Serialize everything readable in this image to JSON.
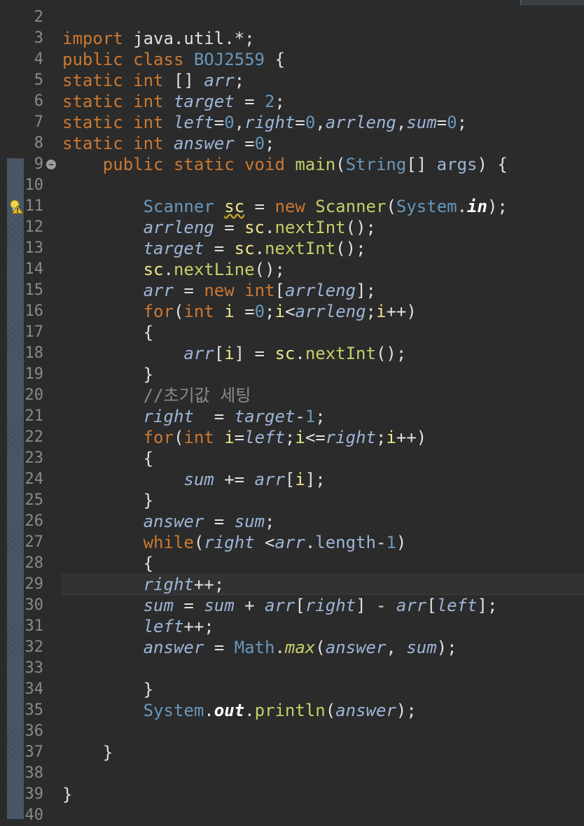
{
  "editor": {
    "lines": [
      {
        "n": "2"
      },
      {
        "n": "3"
      },
      {
        "n": "4"
      },
      {
        "n": "5"
      },
      {
        "n": "6"
      },
      {
        "n": "7"
      },
      {
        "n": "8"
      },
      {
        "n": "9"
      },
      {
        "n": "10"
      },
      {
        "n": "11"
      },
      {
        "n": "12"
      },
      {
        "n": "13"
      },
      {
        "n": "14"
      },
      {
        "n": "15"
      },
      {
        "n": "16"
      },
      {
        "n": "17"
      },
      {
        "n": "18"
      },
      {
        "n": "19"
      },
      {
        "n": "20"
      },
      {
        "n": "21"
      },
      {
        "n": "22"
      },
      {
        "n": "23"
      },
      {
        "n": "24"
      },
      {
        "n": "25"
      },
      {
        "n": "26"
      },
      {
        "n": "27"
      },
      {
        "n": "28"
      },
      {
        "n": "29"
      },
      {
        "n": "30"
      },
      {
        "n": "31"
      },
      {
        "n": "32"
      },
      {
        "n": "33"
      },
      {
        "n": "34"
      },
      {
        "n": "35"
      },
      {
        "n": "36"
      },
      {
        "n": "37"
      },
      {
        "n": "38"
      },
      {
        "n": "39"
      },
      {
        "n": "40"
      }
    ],
    "tokens": {
      "l3": [
        "import",
        " java.util.*;"
      ],
      "l4": [
        "public",
        " ",
        "class",
        " ",
        "BOJ2559",
        " {"
      ],
      "l5": [
        "static",
        " ",
        "int",
        " [] ",
        "arr",
        ";"
      ],
      "l6": [
        "static",
        " ",
        "int",
        " ",
        "target",
        " = ",
        "2",
        ";"
      ],
      "l7": [
        "static",
        " ",
        "int",
        " ",
        "left",
        "=",
        "0",
        ",",
        "right",
        "=",
        "0",
        ",",
        "arrleng",
        ",",
        "sum",
        "=",
        "0",
        ";"
      ],
      "l8": [
        "static",
        " ",
        "int",
        " ",
        "answer",
        " =",
        "0",
        ";"
      ],
      "l9": [
        "    ",
        "public",
        " ",
        "static",
        " ",
        "void",
        " ",
        "main",
        "(",
        "String",
        "[] ",
        "args",
        ") {"
      ],
      "l11": [
        "        ",
        "Scanner",
        " ",
        "sc",
        " = ",
        "new",
        " ",
        "Scanner",
        "(",
        "System",
        ".",
        "in",
        ");"
      ],
      "l12": [
        "        ",
        "arrleng",
        " = ",
        "sc",
        ".",
        "nextInt",
        "();"
      ],
      "l13": [
        "        ",
        "target",
        " = ",
        "sc",
        ".",
        "nextInt",
        "();"
      ],
      "l14": [
        "        ",
        "sc",
        ".",
        "nextLine",
        "();"
      ],
      "l15": [
        "        ",
        "arr",
        " = ",
        "new",
        " ",
        "int",
        "[",
        "arrleng",
        "];"
      ],
      "l16": [
        "        ",
        "for",
        "(",
        "int",
        " ",
        "i",
        " =",
        "0",
        ";",
        "i",
        "<",
        "arrleng",
        ";",
        "i",
        "++)"
      ],
      "l17": [
        "        {"
      ],
      "l18": [
        "            ",
        "arr",
        "[",
        "i",
        "] = ",
        "sc",
        ".",
        "nextInt",
        "();"
      ],
      "l19": [
        "        }"
      ],
      "l20": [
        "        ",
        "//초기값 세팅"
      ],
      "l21": [
        "        ",
        "right",
        "  = ",
        "target",
        "-",
        "1",
        ";"
      ],
      "l22": [
        "        ",
        "for",
        "(",
        "int",
        " ",
        "i",
        "=",
        "left",
        ";",
        "i",
        "<=",
        "right",
        ";",
        "i",
        "++)"
      ],
      "l23": [
        "        {"
      ],
      "l24": [
        "            ",
        "sum",
        " += ",
        "arr",
        "[",
        "i",
        "];"
      ],
      "l25": [
        "        }"
      ],
      "l26": [
        "        ",
        "answer",
        " = ",
        "sum",
        ";"
      ],
      "l27": [
        "        ",
        "while",
        "(",
        "right",
        " <",
        "arr",
        ".",
        "length",
        "-",
        "1",
        ")"
      ],
      "l28": [
        "        {"
      ],
      "l29": [
        "        ",
        "right",
        "++;"
      ],
      "l30": [
        "        ",
        "sum",
        " = ",
        "sum",
        " + ",
        "arr",
        "[",
        "right",
        "] - ",
        "arr",
        "[",
        "left",
        "];"
      ],
      "l31": [
        "        ",
        "left",
        "++;"
      ],
      "l32": [
        "        ",
        "answer",
        " = ",
        "Math",
        ".",
        "max",
        "(",
        "answer",
        ", ",
        "sum",
        ");"
      ],
      "l34": [
        "        }"
      ],
      "l35": [
        "        ",
        "System",
        ".",
        "out",
        ".",
        "println",
        "(",
        "answer",
        ");"
      ],
      "l37": [
        "    }"
      ],
      "l39": [
        "}"
      ]
    },
    "fold_marker": "−",
    "current_line": "29"
  },
  "icons": {
    "fold": "collapse-icon",
    "warning": "warning-lightbulb-icon"
  }
}
